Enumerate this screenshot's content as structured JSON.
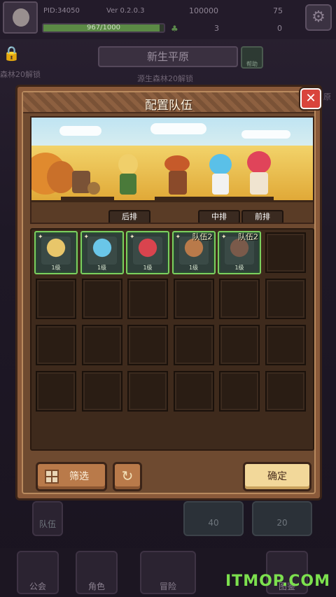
{
  "status": {
    "pid": "PID:34050",
    "version": "Ver 0.2.0.3",
    "xp_text": "967/1000",
    "xp_progress": 0.967,
    "gold": "100000",
    "gems": "75",
    "item_a": "3",
    "item_b": "0"
  },
  "background": {
    "area_name": "新生平原",
    "help": "帮助",
    "unlock_hint": "森林20解锁",
    "stage_hint": "源生森林20解锁",
    "right_hint": "原",
    "cards": [
      {
        "value": "40"
      },
      {
        "value": "20"
      }
    ],
    "tab_team": "队伍"
  },
  "nav": {
    "items": [
      {
        "label": "公会"
      },
      {
        "label": "角色"
      },
      {
        "label": "冒险"
      },
      {
        "label": "图鉴"
      }
    ]
  },
  "modal": {
    "title": "配置队伍",
    "close": "✕",
    "row_labels": {
      "back": "后排",
      "middle": "中排",
      "front": "前排"
    },
    "heroes": [
      {
        "level": "1级",
        "team": "",
        "color": "#e8c66a"
      },
      {
        "level": "1级",
        "team": "",
        "color": "#6ac6e8"
      },
      {
        "level": "1级",
        "team": "",
        "color": "#d9444e"
      },
      {
        "level": "1级",
        "team": "队伍2",
        "color": "#b97a4a"
      },
      {
        "level": "1级",
        "team": "队伍2",
        "color": "#7a5a4a"
      }
    ],
    "filter_label": "筛选",
    "refresh_icon": "↻",
    "confirm_label": "确定"
  },
  "watermark": "ITMOP.COM",
  "colors": {
    "hero_border": "#7bd05e",
    "close_red": "#d9443c",
    "confirm": "#f2d89a",
    "watermark": "#7ce04e"
  }
}
